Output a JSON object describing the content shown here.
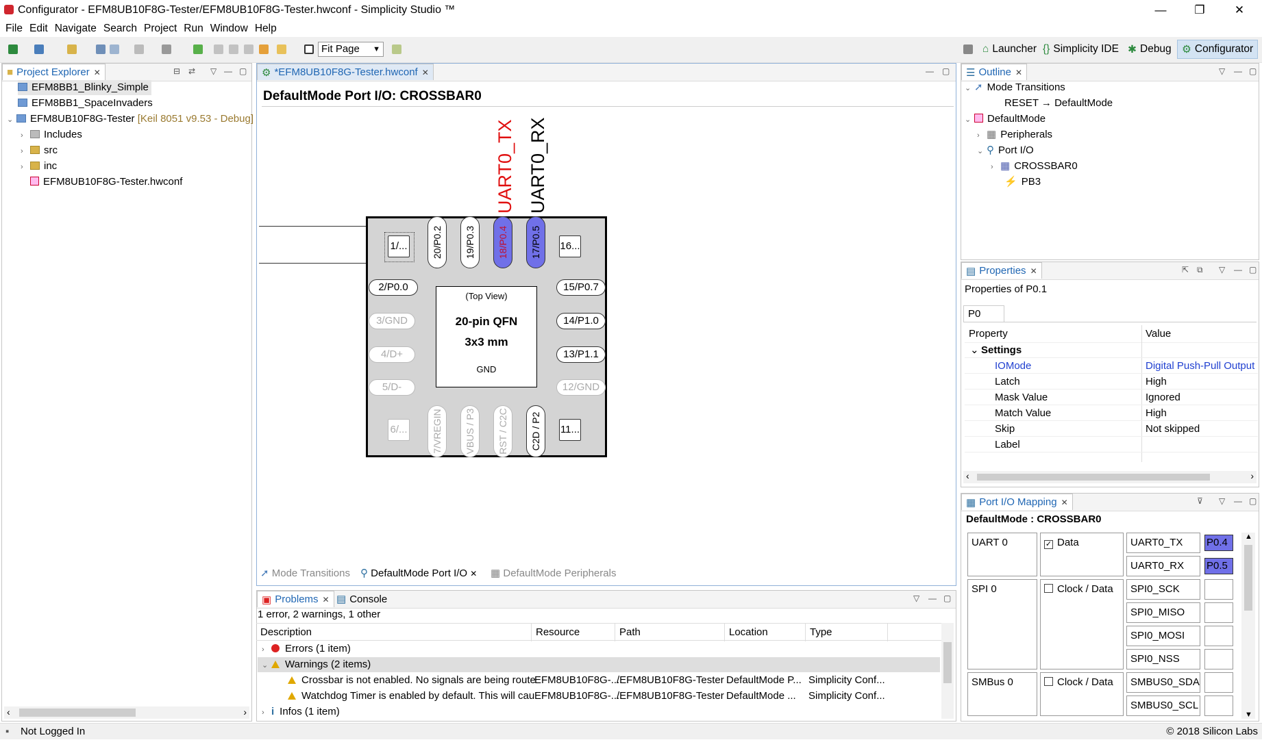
{
  "window": {
    "title": "Configurator - EFM8UB10F8G-Tester/EFM8UB10F8G-Tester.hwconf - Simplicity Studio ™",
    "minimize": "—",
    "maximize": "❐",
    "close": "✕"
  },
  "menu": [
    "File",
    "Edit",
    "Navigate",
    "Search",
    "Project",
    "Run",
    "Window",
    "Help"
  ],
  "toolbar": {
    "zoom_value": "Fit Page"
  },
  "perspectives": [
    "Launcher",
    "Simplicity IDE",
    "Debug",
    "Configurator"
  ],
  "project_explorer": {
    "tab": "Project Explorer",
    "items": [
      {
        "label": "EFM8BB1_Blinky_Simple",
        "selected": true
      },
      {
        "label": "EFM8BB1_SpaceInvaders"
      },
      {
        "label": "EFM8UB10F8G-Tester",
        "decoration": "[Keil 8051 v9.53 - Debug]"
      },
      {
        "label": "Includes"
      },
      {
        "label": "src"
      },
      {
        "label": "inc"
      },
      {
        "label": "EFM8UB10F8G-Tester.hwconf"
      }
    ]
  },
  "editor": {
    "tab": "*EFM8UB10F8G-Tester.hwconf",
    "heading": "DefaultMode Port I/O: CROSSBAR0",
    "signals": {
      "tx": "UART0_TX",
      "rx": "UART0_RX"
    },
    "chip": {
      "top_view": "(Top View)",
      "package": "20-pin QFN",
      "size": "3x3 mm",
      "gnd": "GND"
    },
    "pins": {
      "p1": "1/...",
      "p2": "2/P0.0",
      "p3": "3/GND",
      "p4": "4/D+",
      "p5": "5/D-",
      "p6": "6/...",
      "p7": "7/VREGIN",
      "p8": "VBUS / P3",
      "p9": "RST / C2C",
      "p10": "C2D / P2",
      "p11": "11...",
      "p12": "12/GND",
      "p13": "13/P1.1",
      "p14": "14/P1.0",
      "p15": "15/P0.7",
      "p16": "16...",
      "p17": "17/P0.5",
      "p18": "18/P0.4",
      "p19": "19/P0.3",
      "p20": "20/P0.2"
    },
    "bottom_tabs": [
      "Mode Transitions",
      "DefaultMode Port I/O",
      "DefaultMode Peripherals"
    ]
  },
  "problems": {
    "tabs": [
      "Problems",
      "Console"
    ],
    "summary": "1 error, 2 warnings, 1 other",
    "columns": [
      "Description",
      "Resource",
      "Path",
      "Location",
      "Type"
    ],
    "rows": [
      {
        "kind": "group",
        "icon": "error",
        "text": "Errors (1 item)",
        "expanded": false
      },
      {
        "kind": "group",
        "icon": "warning",
        "text": "Warnings (2 items)",
        "expanded": true
      },
      {
        "kind": "item",
        "icon": "warning",
        "text": "Crossbar is not enabled. No signals are being route",
        "resource": "EFM8UB10F8G-...",
        "path": "/EFM8UB10F8G-Tester",
        "location": "DefaultMode P...",
        "type": "Simplicity Conf..."
      },
      {
        "kind": "item",
        "icon": "warning",
        "text": "Watchdog Timer is enabled by default. This will cau",
        "resource": "EFM8UB10F8G-...",
        "path": "/EFM8UB10F8G-Tester",
        "location": "DefaultMode ...",
        "type": "Simplicity Conf..."
      },
      {
        "kind": "group",
        "icon": "info",
        "text": "Infos (1 item)",
        "expanded": false
      }
    ]
  },
  "outline": {
    "tab": "Outline",
    "items": [
      "Mode Transitions",
      "RESET → DefaultMode",
      "DefaultMode",
      "Peripherals",
      "Port I/O",
      "CROSSBAR0",
      "PB3"
    ]
  },
  "properties": {
    "tab": "Properties",
    "title": "Properties of P0.1",
    "subtab": "P0",
    "col_property": "Property",
    "col_value": "Value",
    "section": "Settings",
    "rows": [
      {
        "key": "IOMode",
        "value": "Digital Push-Pull Output",
        "highlight": true
      },
      {
        "key": "Latch",
        "value": "High"
      },
      {
        "key": "Mask Value",
        "value": "Ignored"
      },
      {
        "key": "Match Value",
        "value": "High"
      },
      {
        "key": "Skip",
        "value": "Not skipped"
      },
      {
        "key": "Label",
        "value": ""
      }
    ]
  },
  "port_mapping": {
    "tab": "Port I/O Mapping",
    "heading": "DefaultMode : CROSSBAR0",
    "groups": [
      {
        "name": "UART 0",
        "option": "Data",
        "checked": true,
        "signals": [
          {
            "name": "UART0_TX",
            "pin": "P0.4"
          },
          {
            "name": "UART0_RX",
            "pin": "P0.5"
          }
        ]
      },
      {
        "name": "SPI 0",
        "option": "Clock / Data",
        "checked": false,
        "signals": [
          {
            "name": "SPI0_SCK",
            "pin": ""
          },
          {
            "name": "SPI0_MISO",
            "pin": ""
          },
          {
            "name": "SPI0_MOSI",
            "pin": ""
          },
          {
            "name": "SPI0_NSS",
            "pin": ""
          }
        ]
      },
      {
        "name": "SMBus 0",
        "option": "Clock / Data",
        "checked": false,
        "signals": [
          {
            "name": "SMBUS0_SDA",
            "pin": ""
          },
          {
            "name": "SMBUS0_SCL",
            "pin": ""
          }
        ]
      }
    ]
  },
  "status": {
    "left": "Not Logged In",
    "right": "© 2018 Silicon Labs"
  },
  "colors": {
    "pin_assigned": "#7070e8",
    "signal_tx": "#e01010",
    "tab_active_text": "#1f66b3",
    "perspective_active_bg": "#d3e3f3"
  }
}
